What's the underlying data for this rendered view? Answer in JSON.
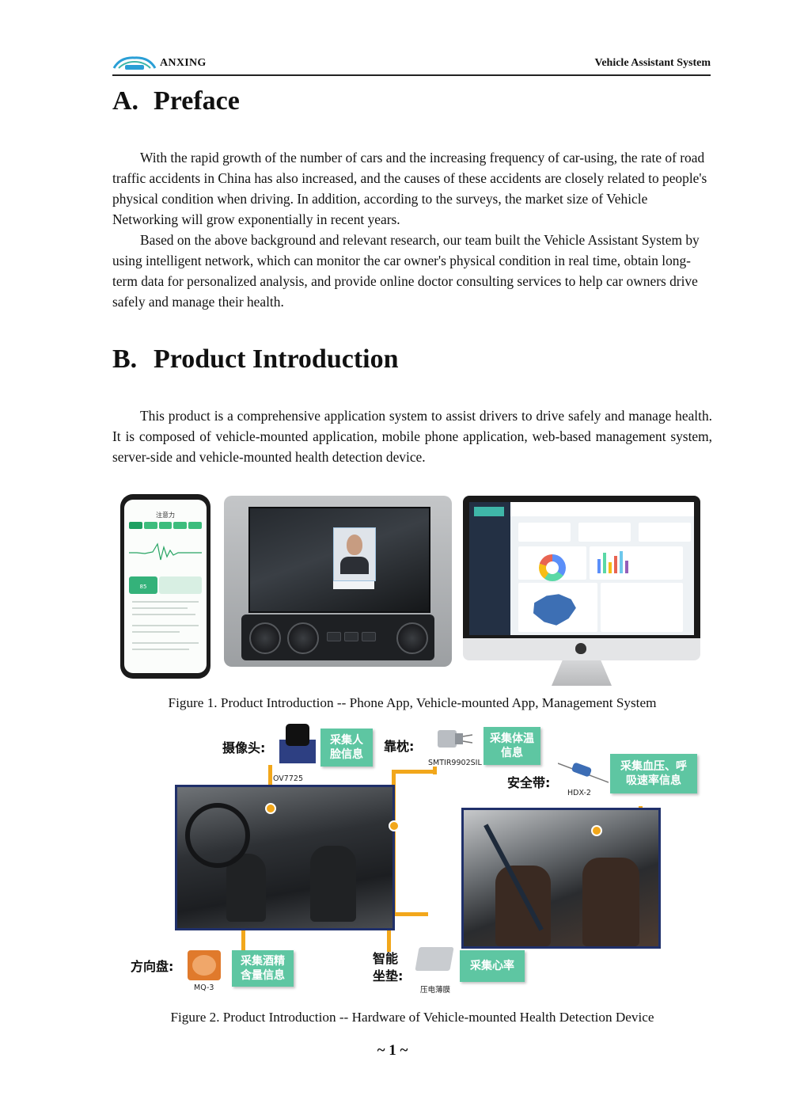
{
  "header": {
    "brand": "ANXING",
    "doc_title": "Vehicle Assistant System"
  },
  "sections": [
    {
      "num": "A.",
      "title": "Preface"
    },
    {
      "num": "B.",
      "title": "Product Introduction"
    }
  ],
  "preface": [
    "With the rapid growth of the number of cars and the increasing frequency of car-using, the rate of road traffic accidents in China has also increased, and the causes of these accidents are closely related to people's physical condition when driving. In addition, according to the surveys, the market size of Vehicle Networking will grow exponentially in recent years.",
    "Based on the above background and relevant research, our team built the Vehicle Assistant System by using intelligent network, which can monitor the car owner's physical condition in real time, obtain long-term data for personalized analysis, and provide online doctor consulting services to help car owners drive safely and manage their health."
  ],
  "intro": "This product is a comprehensive application system to assist drivers to drive safely and manage health. It is composed of vehicle-mounted application, mobile phone application, web-based management system, server-side and vehicle-mounted health detection device.",
  "figure1": {
    "caption": "Figure 1. Product Introduction -- Phone App, Vehicle-mounted App, Management System",
    "phone_title": "注意力",
    "phone_score": "85"
  },
  "figure2": {
    "caption": "Figure 2. Product Introduction -- Hardware of Vehicle-mounted Health Detection Device",
    "labels": {
      "camera": "摄像头:",
      "headrest": "靠枕:",
      "seatbelt": "安全带:",
      "wheel": "方向盘:",
      "seat_line1": "智能",
      "seat_line2": "坐垫:"
    },
    "parts": {
      "camera": "OV7725",
      "headrest": "SMTIR9902SIL",
      "seatbelt": "HDX-2",
      "wheel": "MQ-3",
      "seat": "压电薄膜"
    },
    "tags": {
      "face": "采集人\n脸信息",
      "temp": "采集体温\n信息",
      "bp": "采集血压、呼\n吸速率信息",
      "alcohol": "采集酒精\n含量信息",
      "heart": "采集心率"
    },
    "colors": {
      "tag": "#5ec6a2",
      "connector": "#f2a71b",
      "frame": "#20306a"
    }
  },
  "page_number": "~ 1 ~"
}
